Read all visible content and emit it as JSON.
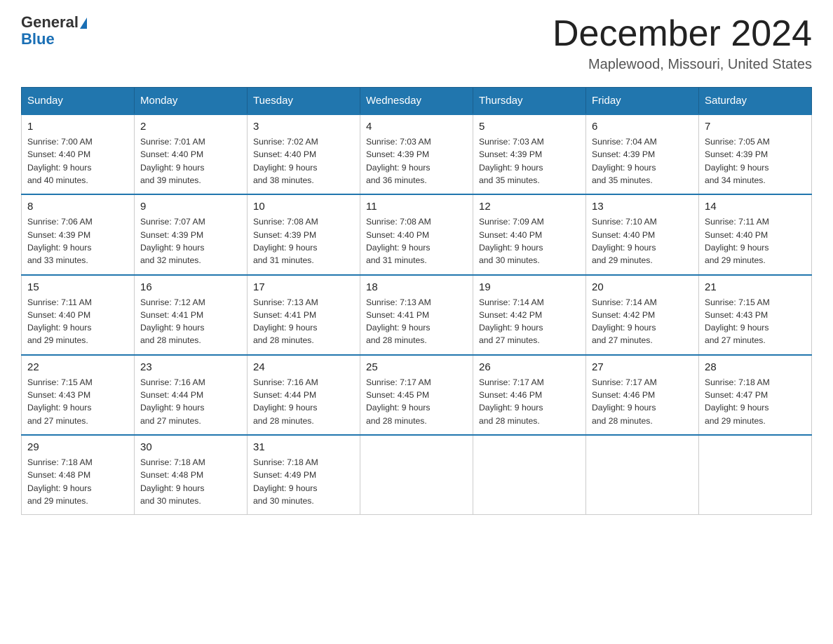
{
  "header": {
    "logo_general": "General",
    "logo_blue": "Blue",
    "month_title": "December 2024",
    "location": "Maplewood, Missouri, United States"
  },
  "weekdays": [
    "Sunday",
    "Monday",
    "Tuesday",
    "Wednesday",
    "Thursday",
    "Friday",
    "Saturday"
  ],
  "weeks": [
    [
      {
        "day": "1",
        "sunrise": "7:00 AM",
        "sunset": "4:40 PM",
        "daylight": "9 hours and 40 minutes."
      },
      {
        "day": "2",
        "sunrise": "7:01 AM",
        "sunset": "4:40 PM",
        "daylight": "9 hours and 39 minutes."
      },
      {
        "day": "3",
        "sunrise": "7:02 AM",
        "sunset": "4:40 PM",
        "daylight": "9 hours and 38 minutes."
      },
      {
        "day": "4",
        "sunrise": "7:03 AM",
        "sunset": "4:39 PM",
        "daylight": "9 hours and 36 minutes."
      },
      {
        "day": "5",
        "sunrise": "7:03 AM",
        "sunset": "4:39 PM",
        "daylight": "9 hours and 35 minutes."
      },
      {
        "day": "6",
        "sunrise": "7:04 AM",
        "sunset": "4:39 PM",
        "daylight": "9 hours and 35 minutes."
      },
      {
        "day": "7",
        "sunrise": "7:05 AM",
        "sunset": "4:39 PM",
        "daylight": "9 hours and 34 minutes."
      }
    ],
    [
      {
        "day": "8",
        "sunrise": "7:06 AM",
        "sunset": "4:39 PM",
        "daylight": "9 hours and 33 minutes."
      },
      {
        "day": "9",
        "sunrise": "7:07 AM",
        "sunset": "4:39 PM",
        "daylight": "9 hours and 32 minutes."
      },
      {
        "day": "10",
        "sunrise": "7:08 AM",
        "sunset": "4:39 PM",
        "daylight": "9 hours and 31 minutes."
      },
      {
        "day": "11",
        "sunrise": "7:08 AM",
        "sunset": "4:40 PM",
        "daylight": "9 hours and 31 minutes."
      },
      {
        "day": "12",
        "sunrise": "7:09 AM",
        "sunset": "4:40 PM",
        "daylight": "9 hours and 30 minutes."
      },
      {
        "day": "13",
        "sunrise": "7:10 AM",
        "sunset": "4:40 PM",
        "daylight": "9 hours and 29 minutes."
      },
      {
        "day": "14",
        "sunrise": "7:11 AM",
        "sunset": "4:40 PM",
        "daylight": "9 hours and 29 minutes."
      }
    ],
    [
      {
        "day": "15",
        "sunrise": "7:11 AM",
        "sunset": "4:40 PM",
        "daylight": "9 hours and 29 minutes."
      },
      {
        "day": "16",
        "sunrise": "7:12 AM",
        "sunset": "4:41 PM",
        "daylight": "9 hours and 28 minutes."
      },
      {
        "day": "17",
        "sunrise": "7:13 AM",
        "sunset": "4:41 PM",
        "daylight": "9 hours and 28 minutes."
      },
      {
        "day": "18",
        "sunrise": "7:13 AM",
        "sunset": "4:41 PM",
        "daylight": "9 hours and 28 minutes."
      },
      {
        "day": "19",
        "sunrise": "7:14 AM",
        "sunset": "4:42 PM",
        "daylight": "9 hours and 27 minutes."
      },
      {
        "day": "20",
        "sunrise": "7:14 AM",
        "sunset": "4:42 PM",
        "daylight": "9 hours and 27 minutes."
      },
      {
        "day": "21",
        "sunrise": "7:15 AM",
        "sunset": "4:43 PM",
        "daylight": "9 hours and 27 minutes."
      }
    ],
    [
      {
        "day": "22",
        "sunrise": "7:15 AM",
        "sunset": "4:43 PM",
        "daylight": "9 hours and 27 minutes."
      },
      {
        "day": "23",
        "sunrise": "7:16 AM",
        "sunset": "4:44 PM",
        "daylight": "9 hours and 27 minutes."
      },
      {
        "day": "24",
        "sunrise": "7:16 AM",
        "sunset": "4:44 PM",
        "daylight": "9 hours and 28 minutes."
      },
      {
        "day": "25",
        "sunrise": "7:17 AM",
        "sunset": "4:45 PM",
        "daylight": "9 hours and 28 minutes."
      },
      {
        "day": "26",
        "sunrise": "7:17 AM",
        "sunset": "4:46 PM",
        "daylight": "9 hours and 28 minutes."
      },
      {
        "day": "27",
        "sunrise": "7:17 AM",
        "sunset": "4:46 PM",
        "daylight": "9 hours and 28 minutes."
      },
      {
        "day": "28",
        "sunrise": "7:18 AM",
        "sunset": "4:47 PM",
        "daylight": "9 hours and 29 minutes."
      }
    ],
    [
      {
        "day": "29",
        "sunrise": "7:18 AM",
        "sunset": "4:48 PM",
        "daylight": "9 hours and 29 minutes."
      },
      {
        "day": "30",
        "sunrise": "7:18 AM",
        "sunset": "4:48 PM",
        "daylight": "9 hours and 30 minutes."
      },
      {
        "day": "31",
        "sunrise": "7:18 AM",
        "sunset": "4:49 PM",
        "daylight": "9 hours and 30 minutes."
      },
      null,
      null,
      null,
      null
    ]
  ],
  "labels": {
    "sunrise": "Sunrise:",
    "sunset": "Sunset:",
    "daylight": "Daylight:"
  }
}
